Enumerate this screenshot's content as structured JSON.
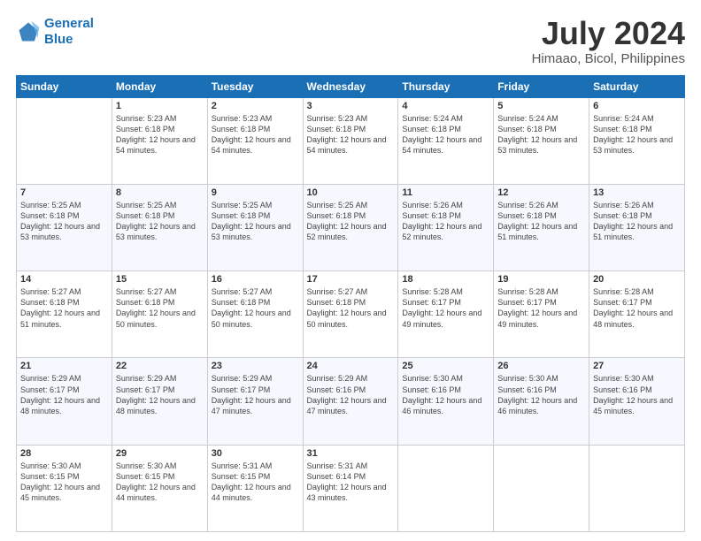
{
  "logo": {
    "line1": "General",
    "line2": "Blue"
  },
  "title": "July 2024",
  "subtitle": "Himaao, Bicol, Philippines",
  "weekdays": [
    "Sunday",
    "Monday",
    "Tuesday",
    "Wednesday",
    "Thursday",
    "Friday",
    "Saturday"
  ],
  "weeks": [
    [
      {
        "day": "",
        "sunrise": "",
        "sunset": "",
        "daylight": ""
      },
      {
        "day": "1",
        "sunrise": "Sunrise: 5:23 AM",
        "sunset": "Sunset: 6:18 PM",
        "daylight": "Daylight: 12 hours and 54 minutes."
      },
      {
        "day": "2",
        "sunrise": "Sunrise: 5:23 AM",
        "sunset": "Sunset: 6:18 PM",
        "daylight": "Daylight: 12 hours and 54 minutes."
      },
      {
        "day": "3",
        "sunrise": "Sunrise: 5:23 AM",
        "sunset": "Sunset: 6:18 PM",
        "daylight": "Daylight: 12 hours and 54 minutes."
      },
      {
        "day": "4",
        "sunrise": "Sunrise: 5:24 AM",
        "sunset": "Sunset: 6:18 PM",
        "daylight": "Daylight: 12 hours and 54 minutes."
      },
      {
        "day": "5",
        "sunrise": "Sunrise: 5:24 AM",
        "sunset": "Sunset: 6:18 PM",
        "daylight": "Daylight: 12 hours and 53 minutes."
      },
      {
        "day": "6",
        "sunrise": "Sunrise: 5:24 AM",
        "sunset": "Sunset: 6:18 PM",
        "daylight": "Daylight: 12 hours and 53 minutes."
      }
    ],
    [
      {
        "day": "7",
        "sunrise": "Sunrise: 5:25 AM",
        "sunset": "Sunset: 6:18 PM",
        "daylight": "Daylight: 12 hours and 53 minutes."
      },
      {
        "day": "8",
        "sunrise": "Sunrise: 5:25 AM",
        "sunset": "Sunset: 6:18 PM",
        "daylight": "Daylight: 12 hours and 53 minutes."
      },
      {
        "day": "9",
        "sunrise": "Sunrise: 5:25 AM",
        "sunset": "Sunset: 6:18 PM",
        "daylight": "Daylight: 12 hours and 53 minutes."
      },
      {
        "day": "10",
        "sunrise": "Sunrise: 5:25 AM",
        "sunset": "Sunset: 6:18 PM",
        "daylight": "Daylight: 12 hours and 52 minutes."
      },
      {
        "day": "11",
        "sunrise": "Sunrise: 5:26 AM",
        "sunset": "Sunset: 6:18 PM",
        "daylight": "Daylight: 12 hours and 52 minutes."
      },
      {
        "day": "12",
        "sunrise": "Sunrise: 5:26 AM",
        "sunset": "Sunset: 6:18 PM",
        "daylight": "Daylight: 12 hours and 51 minutes."
      },
      {
        "day": "13",
        "sunrise": "Sunrise: 5:26 AM",
        "sunset": "Sunset: 6:18 PM",
        "daylight": "Daylight: 12 hours and 51 minutes."
      }
    ],
    [
      {
        "day": "14",
        "sunrise": "Sunrise: 5:27 AM",
        "sunset": "Sunset: 6:18 PM",
        "daylight": "Daylight: 12 hours and 51 minutes."
      },
      {
        "day": "15",
        "sunrise": "Sunrise: 5:27 AM",
        "sunset": "Sunset: 6:18 PM",
        "daylight": "Daylight: 12 hours and 50 minutes."
      },
      {
        "day": "16",
        "sunrise": "Sunrise: 5:27 AM",
        "sunset": "Sunset: 6:18 PM",
        "daylight": "Daylight: 12 hours and 50 minutes."
      },
      {
        "day": "17",
        "sunrise": "Sunrise: 5:27 AM",
        "sunset": "Sunset: 6:18 PM",
        "daylight": "Daylight: 12 hours and 50 minutes."
      },
      {
        "day": "18",
        "sunrise": "Sunrise: 5:28 AM",
        "sunset": "Sunset: 6:17 PM",
        "daylight": "Daylight: 12 hours and 49 minutes."
      },
      {
        "day": "19",
        "sunrise": "Sunrise: 5:28 AM",
        "sunset": "Sunset: 6:17 PM",
        "daylight": "Daylight: 12 hours and 49 minutes."
      },
      {
        "day": "20",
        "sunrise": "Sunrise: 5:28 AM",
        "sunset": "Sunset: 6:17 PM",
        "daylight": "Daylight: 12 hours and 48 minutes."
      }
    ],
    [
      {
        "day": "21",
        "sunrise": "Sunrise: 5:29 AM",
        "sunset": "Sunset: 6:17 PM",
        "daylight": "Daylight: 12 hours and 48 minutes."
      },
      {
        "day": "22",
        "sunrise": "Sunrise: 5:29 AM",
        "sunset": "Sunset: 6:17 PM",
        "daylight": "Daylight: 12 hours and 48 minutes."
      },
      {
        "day": "23",
        "sunrise": "Sunrise: 5:29 AM",
        "sunset": "Sunset: 6:17 PM",
        "daylight": "Daylight: 12 hours and 47 minutes."
      },
      {
        "day": "24",
        "sunrise": "Sunrise: 5:29 AM",
        "sunset": "Sunset: 6:16 PM",
        "daylight": "Daylight: 12 hours and 47 minutes."
      },
      {
        "day": "25",
        "sunrise": "Sunrise: 5:30 AM",
        "sunset": "Sunset: 6:16 PM",
        "daylight": "Daylight: 12 hours and 46 minutes."
      },
      {
        "day": "26",
        "sunrise": "Sunrise: 5:30 AM",
        "sunset": "Sunset: 6:16 PM",
        "daylight": "Daylight: 12 hours and 46 minutes."
      },
      {
        "day": "27",
        "sunrise": "Sunrise: 5:30 AM",
        "sunset": "Sunset: 6:16 PM",
        "daylight": "Daylight: 12 hours and 45 minutes."
      }
    ],
    [
      {
        "day": "28",
        "sunrise": "Sunrise: 5:30 AM",
        "sunset": "Sunset: 6:15 PM",
        "daylight": "Daylight: 12 hours and 45 minutes."
      },
      {
        "day": "29",
        "sunrise": "Sunrise: 5:30 AM",
        "sunset": "Sunset: 6:15 PM",
        "daylight": "Daylight: 12 hours and 44 minutes."
      },
      {
        "day": "30",
        "sunrise": "Sunrise: 5:31 AM",
        "sunset": "Sunset: 6:15 PM",
        "daylight": "Daylight: 12 hours and 44 minutes."
      },
      {
        "day": "31",
        "sunrise": "Sunrise: 5:31 AM",
        "sunset": "Sunset: 6:14 PM",
        "daylight": "Daylight: 12 hours and 43 minutes."
      },
      {
        "day": "",
        "sunrise": "",
        "sunset": "",
        "daylight": ""
      },
      {
        "day": "",
        "sunrise": "",
        "sunset": "",
        "daylight": ""
      },
      {
        "day": "",
        "sunrise": "",
        "sunset": "",
        "daylight": ""
      }
    ]
  ]
}
